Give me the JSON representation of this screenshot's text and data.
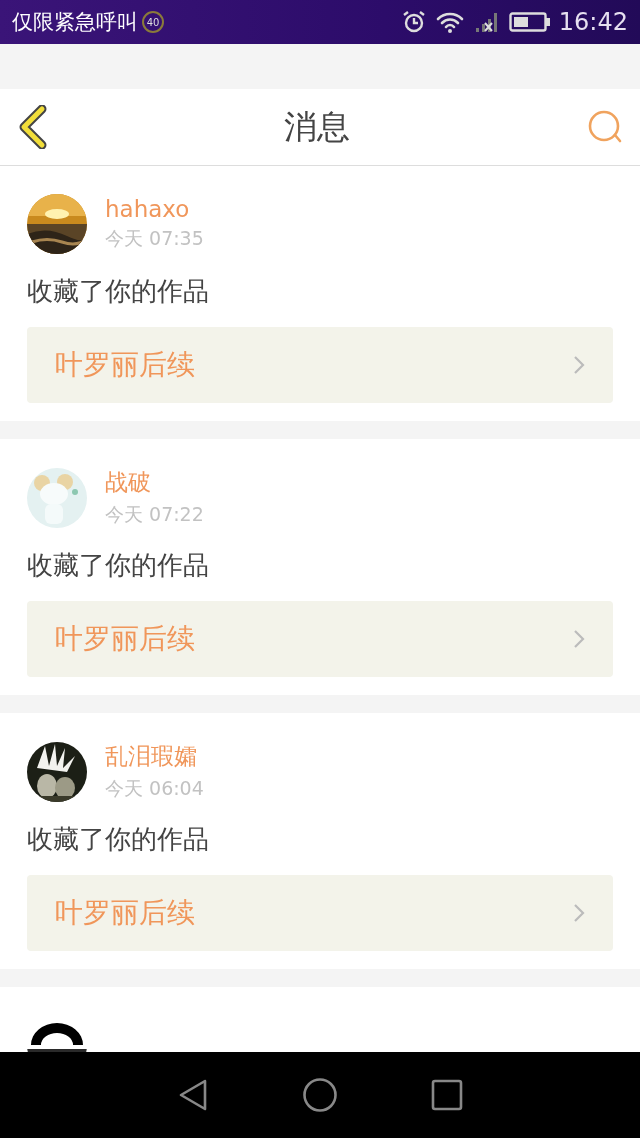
{
  "status_bar": {
    "carrier": "仅限紧急呼叫",
    "badge": "40",
    "time": "16:42"
  },
  "header": {
    "title": "消息"
  },
  "messages": [
    {
      "user": "hahaxo",
      "time": "今天 07:35",
      "action": "收藏了你的作品",
      "work": "叶罗丽后续"
    },
    {
      "user": "战破",
      "time": "今天 07:22",
      "action": "收藏了你的作品",
      "work": "叶罗丽后续"
    },
    {
      "user": "乱泪瑕孀",
      "time": "今天 06:04",
      "action": "收藏了你的作品",
      "work": "叶罗丽后续"
    }
  ]
}
